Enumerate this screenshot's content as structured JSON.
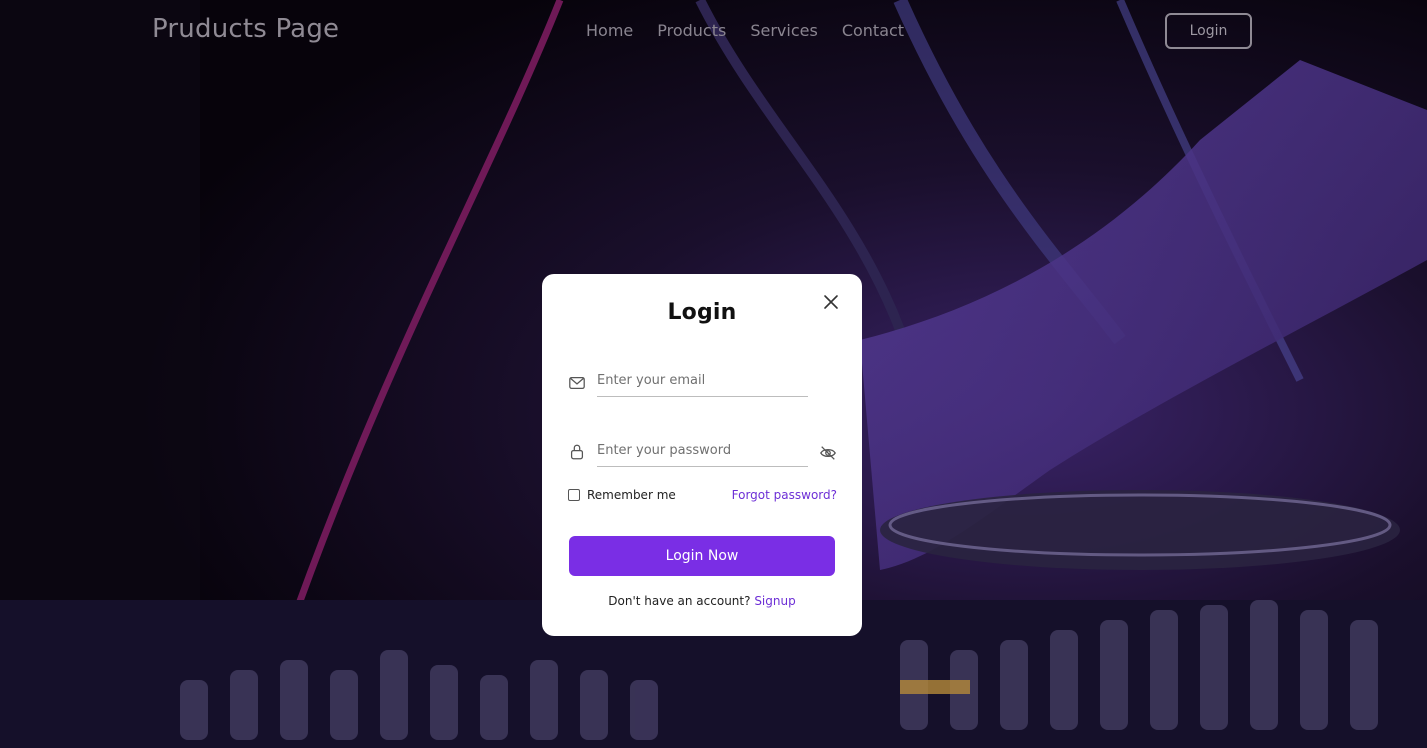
{
  "header": {
    "logo": "Pruducts Page",
    "nav": [
      "Home",
      "Products",
      "Services",
      "Contact"
    ],
    "login_button": "Login"
  },
  "modal": {
    "title": "Login",
    "email_placeholder": "Enter your email",
    "password_placeholder": "Enter your password",
    "remember_label": "Remember me",
    "forgot_link": "Forgot password?",
    "submit_label": "Login Now",
    "signup_prompt": "Don't have an account?",
    "signup_link": "Signup"
  },
  "icons": {
    "close": "close-icon",
    "email": "mail-icon",
    "password": "lock-icon",
    "toggle_visibility": "eye-off-icon"
  },
  "colors": {
    "accent": "#7a2ee5",
    "link": "#6d2fd6",
    "nav_text": "#8a8590",
    "modal_bg": "#ffffff"
  }
}
